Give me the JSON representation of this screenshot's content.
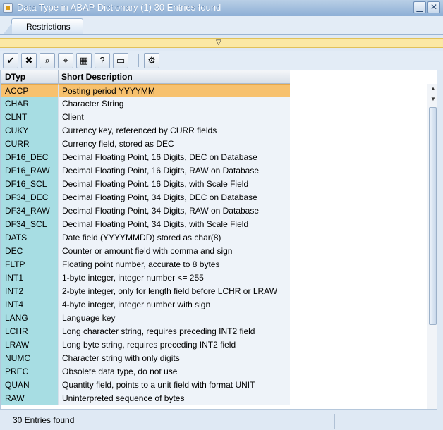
{
  "window": {
    "title": "Data Type in ABAP Dictionary (1)   30 Entries found",
    "min_label": "▁",
    "close_label": "✕"
  },
  "tabs": [
    {
      "label": "Restrictions"
    }
  ],
  "collapse_arrow": "▽",
  "toolbar": {
    "buttons": [
      {
        "icon": "✔",
        "name": "continue"
      },
      {
        "icon": "✖",
        "name": "cancel"
      },
      {
        "icon": "⌕",
        "name": "find"
      },
      {
        "icon": "⌖",
        "name": "find-next"
      },
      {
        "icon": "▦",
        "name": "sort"
      },
      {
        "icon": "?",
        "name": "help"
      },
      {
        "icon": "▭",
        "name": "print"
      },
      {
        "icon": "⚙",
        "name": "settings"
      }
    ]
  },
  "table": {
    "headers": [
      "DTyp",
      "Short Description"
    ],
    "rows": [
      [
        "ACCP",
        "Posting period YYYYMM"
      ],
      [
        "CHAR",
        "Character String"
      ],
      [
        "CLNT",
        "Client"
      ],
      [
        "CUKY",
        "Currency key, referenced by CURR fields"
      ],
      [
        "CURR",
        "Currency field, stored as DEC"
      ],
      [
        "DF16_DEC",
        "Decimal Floating Point, 16 Digits, DEC on Database"
      ],
      [
        "DF16_RAW",
        "Decimal Floating Point, 16 Digits,  RAW on Database"
      ],
      [
        "DF16_SCL",
        "Decimal Floating Point. 16 Digits, with Scale Field"
      ],
      [
        "DF34_DEC",
        "Decimal Floating Point, 34 Digits, DEC on Database"
      ],
      [
        "DF34_RAW",
        "Decimal Floating Point, 34 Digits, RAW on Database"
      ],
      [
        "DF34_SCL",
        "Decimal Floating Point, 34 Digits, with Scale Field"
      ],
      [
        "DATS",
        "Date field (YYYYMMDD) stored as char(8)"
      ],
      [
        "DEC",
        "Counter or amount field with comma and sign"
      ],
      [
        "FLTP",
        "Floating point number, accurate to 8 bytes"
      ],
      [
        "INT1",
        "1-byte integer, integer number <= 255"
      ],
      [
        "INT2",
        "2-byte integer, only for length field before LCHR or LRAW"
      ],
      [
        "INT4",
        "4-byte integer, integer number with sign"
      ],
      [
        "LANG",
        "Language key"
      ],
      [
        "LCHR",
        "Long character string, requires preceding INT2 field"
      ],
      [
        "LRAW",
        "Long byte string, requires preceding INT2 field"
      ],
      [
        "NUMC",
        "Character string with only digits"
      ],
      [
        "PREC",
        "Obsolete data type, do not use"
      ],
      [
        "QUAN",
        "Quantity field, points to a unit field with format UNIT"
      ],
      [
        "RAW",
        "Uninterpreted sequence of bytes"
      ]
    ]
  },
  "scrollbar": {
    "up": "▲",
    "down": "▼"
  },
  "status": {
    "text": "30 Entries found"
  },
  "colors": {
    "selected_row": "#f7c16e",
    "key_column": "#a7dde3",
    "title_bar": "#8fb0d6"
  }
}
